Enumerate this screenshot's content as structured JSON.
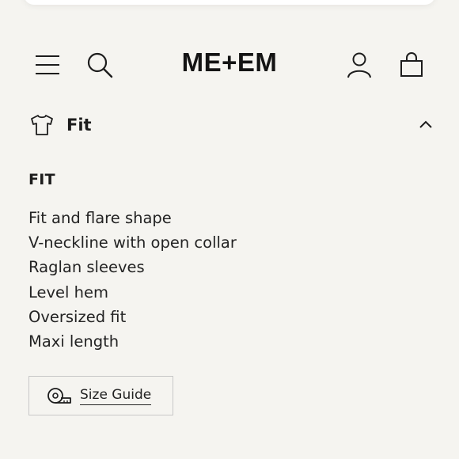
{
  "header": {
    "logo": "ME+EM"
  },
  "accordion": {
    "title": "Fit",
    "expanded": true
  },
  "section": {
    "heading": "FIT",
    "items": [
      "Fit and flare shape",
      "V-neckline with open collar",
      "Raglan sleeves",
      "Level hem",
      "Oversized fit",
      "Maxi length"
    ]
  },
  "size_guide": {
    "label": "Size Guide"
  },
  "icons": {
    "menu": "hamburger-menu-icon",
    "search": "search-icon",
    "account": "user-icon",
    "bag": "shopping-bag-icon",
    "fit": "t-shirt-icon",
    "collapse": "chevron-up-icon",
    "size_guide": "tape-measure-icon"
  },
  "colors": {
    "background": "#f5f4f0",
    "text": "#1c1c1c",
    "border": "#c8c8c8"
  }
}
